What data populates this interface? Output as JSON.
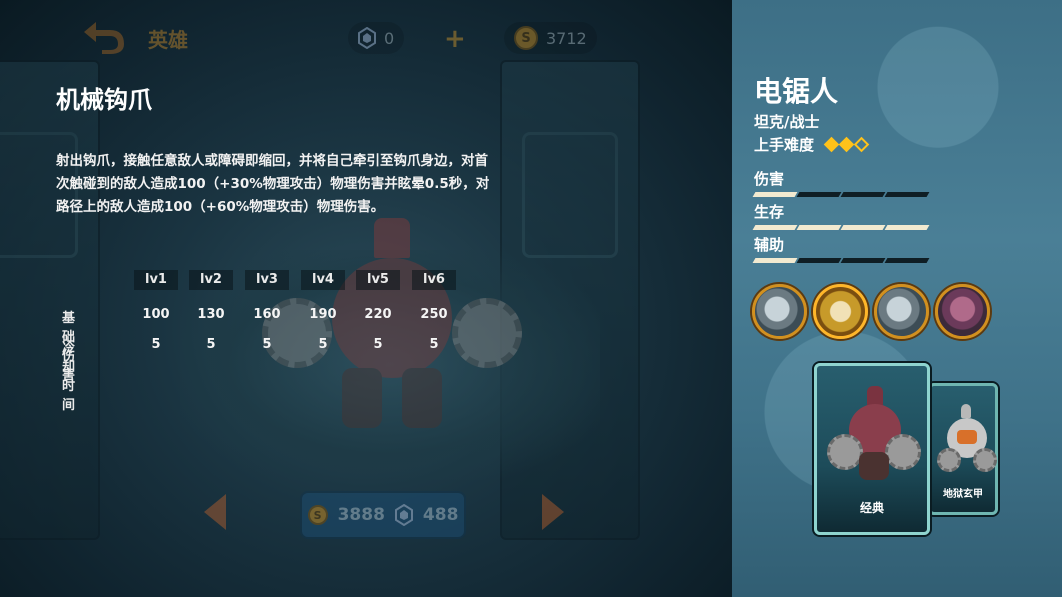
{
  "topbar": {
    "hero_tab_label": "英雄",
    "gems": "0",
    "coins": "3712",
    "coin_symbol": "S"
  },
  "skill": {
    "title": "机械钩爪",
    "description": "射出钩爪，接触任意敌人或障碍即缩回，并将自己牵引至钩爪身边，对首次触碰到的敌人造成100（+30%物理攻击）物理伤害并眩晕0.5秒，对路径上的敌人造成100（+60%物理攻击）物理伤害。",
    "levels": [
      "lv1",
      "lv2",
      "lv3",
      "lv4",
      "lv5",
      "lv6"
    ],
    "rows": [
      {
        "label": "基础伤害",
        "values": [
          "100",
          "130",
          "160",
          "190",
          "220",
          "250"
        ]
      },
      {
        "label": "冷却时间",
        "values": [
          "5",
          "5",
          "5",
          "5",
          "5",
          "5"
        ]
      }
    ]
  },
  "purchase": {
    "coin_price": "3888",
    "gem_price": "488",
    "coin_symbol": "S"
  },
  "hero": {
    "name": "电锯人",
    "role": "坦克/战士",
    "difficulty_label": "上手难度",
    "difficulty": {
      "filled": 2,
      "max": 3
    },
    "stats": [
      {
        "label": "伤害",
        "filled": 1,
        "max": 4
      },
      {
        "label": "生存",
        "filled": 4,
        "max": 4
      },
      {
        "label": "辅助",
        "filled": 1,
        "max": 4
      }
    ],
    "skill_icons": [
      "saw-blade-icon",
      "claw-icon",
      "spin-icon",
      "hero-portrait-icon"
    ],
    "skins": [
      {
        "name": "经典"
      },
      {
        "name": "地狱玄甲"
      }
    ]
  },
  "colors": {
    "accent_gold": "#ffc21a",
    "panel_bg": "#4a7f96",
    "card_border": "#8fd4cf"
  }
}
